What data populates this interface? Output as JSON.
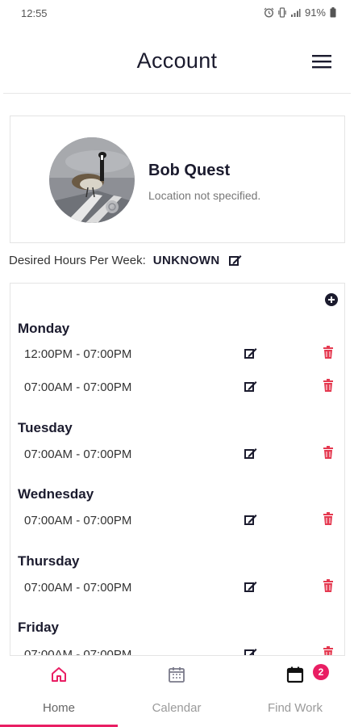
{
  "status_bar": {
    "time": "12:55",
    "battery": "91%",
    "icons": [
      "alarm-icon",
      "vibrate-icon",
      "signal-icon",
      "battery-icon"
    ]
  },
  "header": {
    "title": "Account",
    "menu_icon": "hamburger-menu-icon"
  },
  "profile": {
    "name": "Bob Quest",
    "location": "Location not specified.",
    "avatar_icon": "avatar-photo"
  },
  "desired_hours": {
    "label": "Desired Hours Per Week:",
    "value": "UNKNOWN"
  },
  "schedule": {
    "days": [
      {
        "name": "Monday",
        "slots": [
          "12:00PM - 07:00PM",
          "07:00AM - 07:00PM"
        ]
      },
      {
        "name": "Tuesday",
        "slots": [
          "07:00AM - 07:00PM"
        ]
      },
      {
        "name": "Wednesday",
        "slots": [
          "07:00AM - 07:00PM"
        ]
      },
      {
        "name": "Thursday",
        "slots": [
          "07:00AM - 07:00PM"
        ]
      },
      {
        "name": "Friday",
        "slots": [
          "07:00AM - 07:00PM"
        ]
      }
    ]
  },
  "nav": {
    "items": [
      {
        "label": "Home",
        "icon": "home-icon",
        "active": true
      },
      {
        "label": "Calendar",
        "icon": "calendar-icon",
        "active": false
      },
      {
        "label": "Find Work",
        "icon": "calendar-filled-icon",
        "active": false,
        "badge": "2"
      }
    ]
  },
  "colors": {
    "accent": "#e91e63",
    "navy": "#1b1b2e",
    "delete": "#e53950"
  }
}
